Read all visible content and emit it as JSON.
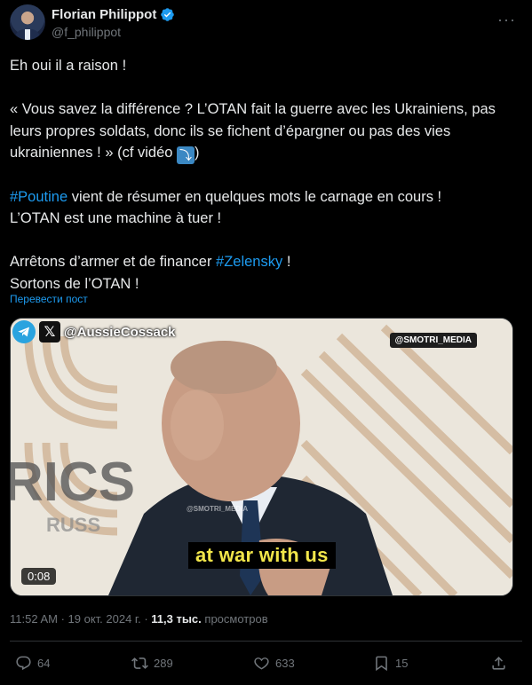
{
  "author": {
    "display_name": "Florian Philippot",
    "handle": "@f_philippot"
  },
  "tweet": {
    "line1": "Eh oui il a raison !",
    "line2": "« Vous savez la différence ? L’OTAN fait la guerre avec les Ukrainiens, pas leurs propres soldats, donc ils se fichent d’épargner ou pas des vies ukrainiennes ! » (cf vidéo ",
    "line2_end": ")",
    "hashtag1": "#Poutine",
    "line3_rest": " vient de résumer en quelques mots le carnage en cours !",
    "line4": "L’OTAN est une machine à tuer !",
    "line5_start": "Arrêtons d’armer et de financer ",
    "hashtag2": "#Zelensky",
    "line5_end": " !",
    "line6": "Sortons de l’OTAN !",
    "translate_label": "Перевести пост"
  },
  "media": {
    "overlay_handle": "@AussieCossack",
    "badge": "@SMOTRI_MEDIA",
    "watermark": "@SMOTRI_MEDIA",
    "bg_text": "RICS",
    "bg_text2": "RUSS",
    "subtitle": "at war with us",
    "duration": "0:08"
  },
  "meta": {
    "time": "11:52 AM",
    "sep": " · ",
    "date": "19 окт. 2024 г.",
    "views_num": "11,3 тыс.",
    "views_label": "просмотров"
  },
  "actions": {
    "replies": "64",
    "reposts": "289",
    "likes": "633",
    "bookmarks": "15"
  },
  "colors": {
    "accent": "#1d9bf0",
    "background": "#000000",
    "text": "#e7e9ea",
    "muted": "#71767b",
    "subtitle": "#f2e64a"
  }
}
